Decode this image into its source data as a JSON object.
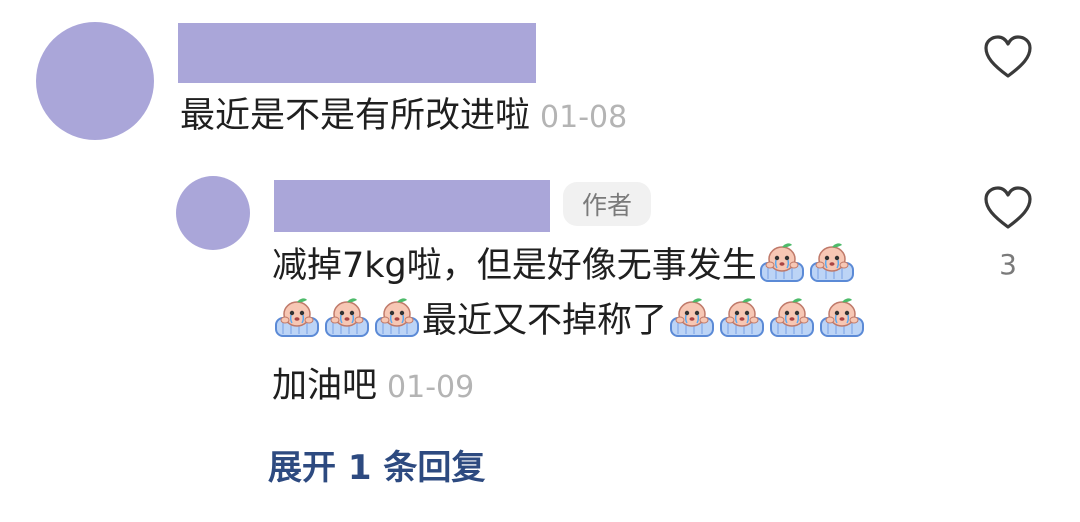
{
  "comment": {
    "text": "最近是不是有所改进啦",
    "date": "01-08"
  },
  "reply": {
    "author_badge": "作者",
    "line1": "减掉7kg啦，但是好像无事发生",
    "line2": "最近又不掉称了",
    "line3": "加油吧",
    "date": "01-09",
    "like_count": "3",
    "sticker_icon": "crying-peach-sticker"
  },
  "expand_replies": "展开 1 条回复",
  "colors": {
    "avatar_placeholder": "#aaa6d9",
    "link": "#2d4a80",
    "muted": "#b4b4b4"
  }
}
